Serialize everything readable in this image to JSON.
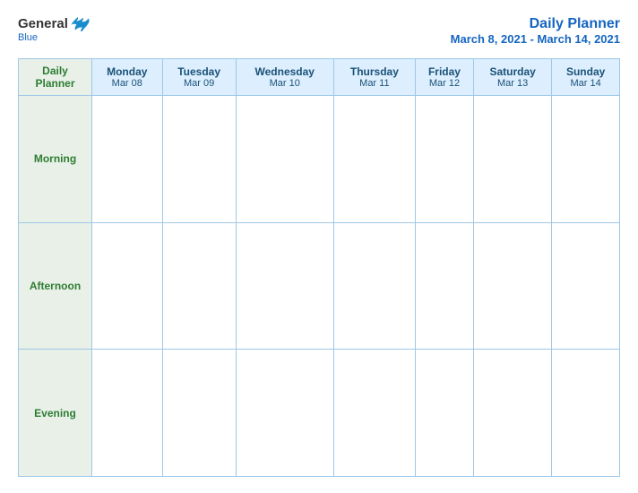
{
  "header": {
    "logo_general": "General",
    "logo_blue": "Blue",
    "title": "Daily Planner",
    "subtitle": "March 8, 2021 - March 14, 2021"
  },
  "columns": [
    {
      "id": "daily-planner-col",
      "day": "Daily",
      "day2": "Planner",
      "date": ""
    },
    {
      "id": "monday-col",
      "day": "Monday",
      "date": "Mar 08"
    },
    {
      "id": "tuesday-col",
      "day": "Tuesday",
      "date": "Mar 09"
    },
    {
      "id": "wednesday-col",
      "day": "Wednesday",
      "date": "Mar 10"
    },
    {
      "id": "thursday-col",
      "day": "Thursday",
      "date": "Mar 11"
    },
    {
      "id": "friday-col",
      "day": "Friday",
      "date": "Mar 12"
    },
    {
      "id": "saturday-col",
      "day": "Saturday",
      "date": "Mar 13"
    },
    {
      "id": "sunday-col",
      "day": "Sunday",
      "date": "Mar 14"
    }
  ],
  "rows": [
    {
      "id": "morning-row",
      "label": "Morning"
    },
    {
      "id": "afternoon-row",
      "label": "Afternoon"
    },
    {
      "id": "evening-row",
      "label": "Evening"
    }
  ]
}
